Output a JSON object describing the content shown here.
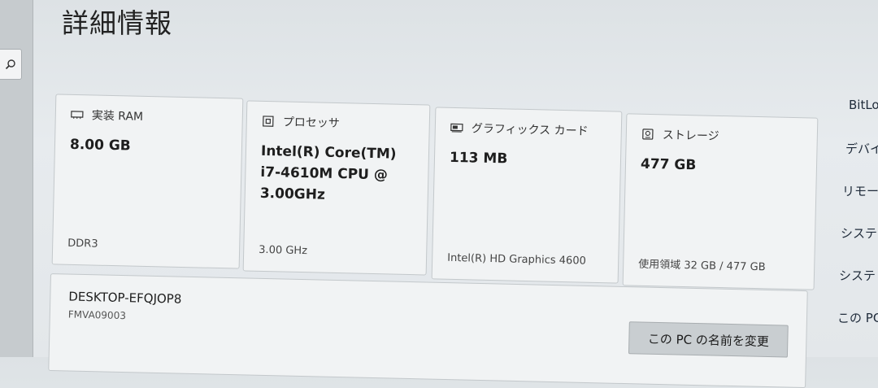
{
  "page": {
    "title": "詳細情報"
  },
  "search": {
    "icon": "search-icon"
  },
  "specs": [
    {
      "id": "ram",
      "icon": "ram-icon",
      "label": "実装 RAM",
      "value": "8.00 GB",
      "footer": "DDR3"
    },
    {
      "id": "processor",
      "icon": "processor-icon",
      "label": "プロセッサ",
      "value": "Intel(R) Core(TM) i7-4610M CPU @ 3.00GHz",
      "footer": "3.00 GHz"
    },
    {
      "id": "graphics",
      "icon": "graphics-card-icon",
      "label": "グラフィックス カード",
      "value": "113 MB",
      "footer": "Intel(R) HD Graphics 4600"
    },
    {
      "id": "storage",
      "icon": "storage-icon",
      "label": "ストレージ",
      "value": "477 GB",
      "footer": "使用領域 32 GB / 477 GB"
    }
  ],
  "device": {
    "name": "DESKTOP-EFQJOP8",
    "model": "FMVA09003",
    "rename_label": "この PC の名前を変更"
  },
  "related_links": [
    "BitLo",
    "デバイ",
    "リモー",
    "システ",
    "システ",
    "この PC"
  ]
}
